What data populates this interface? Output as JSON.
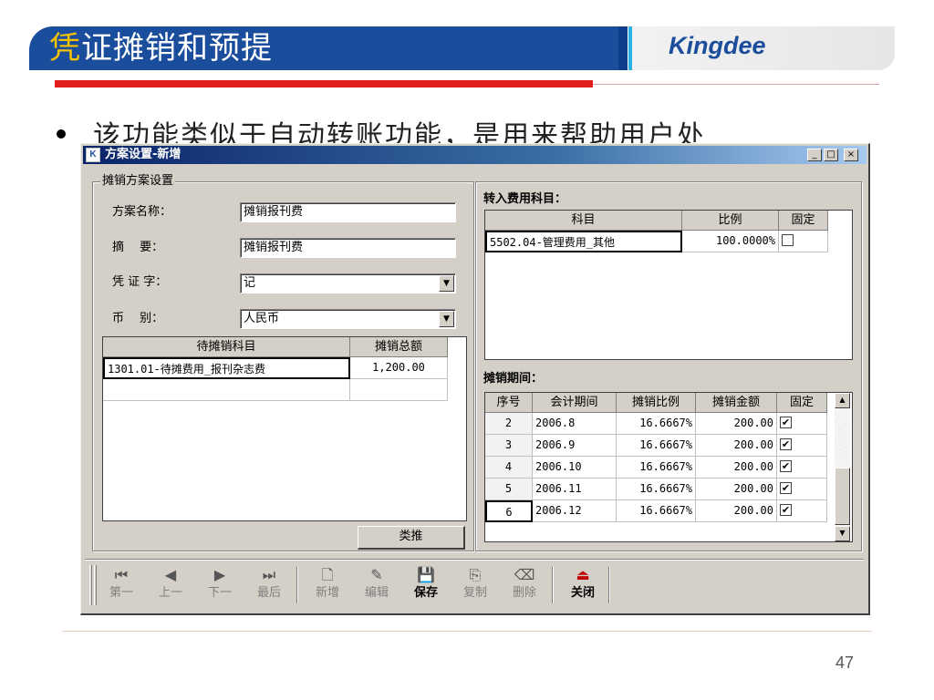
{
  "slide": {
    "title_first": "凭",
    "title_rest": "证摊销和预提",
    "logo": "Kingdee",
    "bullet_text": "该功能类似于自动转账功能，是用来帮助用户处",
    "page_number": "47"
  },
  "window": {
    "icon": "K",
    "title": "方案设置-新增",
    "btn_min": "_",
    "btn_max": "□",
    "btn_close": "×"
  },
  "left_group": {
    "label": "摊销方案设置",
    "scheme_name_label": "方案名称：",
    "scheme_name_value": "摊销报刊费",
    "summary_label": "摘　 要：",
    "summary_value": "摊销报刊费",
    "voucher_label": "凭 证 字：",
    "voucher_value": "记",
    "currency_label": "币　 别：",
    "currency_value": "人民币",
    "dropdown_glyph": "▼",
    "grid_headers": [
      "待摊销科目",
      "摊销总额"
    ],
    "grid_rows": [
      {
        "account": "1301.01-待摊费用_报刊杂志费",
        "amount": "1,200.00"
      },
      {
        "account": "",
        "amount": ""
      }
    ],
    "analogy_button": "类推"
  },
  "right_group": {
    "expense_label": "转入费用科目：",
    "expense_headers": [
      "科目",
      "比例",
      "固定"
    ],
    "expense_rows": [
      {
        "account": "5502.04-管理费用_其他",
        "ratio": "100.0000%",
        "fixed": ""
      }
    ],
    "period_label": "摊销期间：",
    "period_headers": [
      "序号",
      "会计期间",
      "摊销比例",
      "摊销金额",
      "固定"
    ],
    "period_rows": [
      {
        "no": "2",
        "period": "2006.8",
        "ratio": "16.6667%",
        "amount": "200.00",
        "fixed": "✔"
      },
      {
        "no": "3",
        "period": "2006.9",
        "ratio": "16.6667%",
        "amount": "200.00",
        "fixed": "✔"
      },
      {
        "no": "4",
        "period": "2006.10",
        "ratio": "16.6667%",
        "amount": "200.00",
        "fixed": "✔"
      },
      {
        "no": "5",
        "period": "2006.11",
        "ratio": "16.6667%",
        "amount": "200.00",
        "fixed": "✔"
      },
      {
        "no": "6",
        "period": "2006.12",
        "ratio": "16.6667%",
        "amount": "200.00",
        "fixed": "✔"
      }
    ],
    "scroll_up": "▲",
    "scroll_down": "▼"
  },
  "toolbar": {
    "first": {
      "icon": "⏮",
      "label": "第一"
    },
    "prev": {
      "icon": "◀",
      "label": "上一"
    },
    "next": {
      "icon": "▶",
      "label": "下一"
    },
    "last": {
      "icon": "⏭",
      "label": "最后"
    },
    "new": {
      "icon": "🗋",
      "label": "新增"
    },
    "edit": {
      "icon": "✎",
      "label": "编辑"
    },
    "save": {
      "icon": "💾",
      "label": "保存"
    },
    "copy": {
      "icon": "⎘",
      "label": "复制"
    },
    "delete": {
      "icon": "⌫",
      "label": "删除"
    },
    "close": {
      "icon": "⏏",
      "label": "关闭"
    }
  },
  "colors": {
    "title_bar": "#1a4d9c",
    "accent_yellow": "#f5c300",
    "red_rule": "#e01e1e",
    "dialog_face": "#d4d0c8"
  }
}
